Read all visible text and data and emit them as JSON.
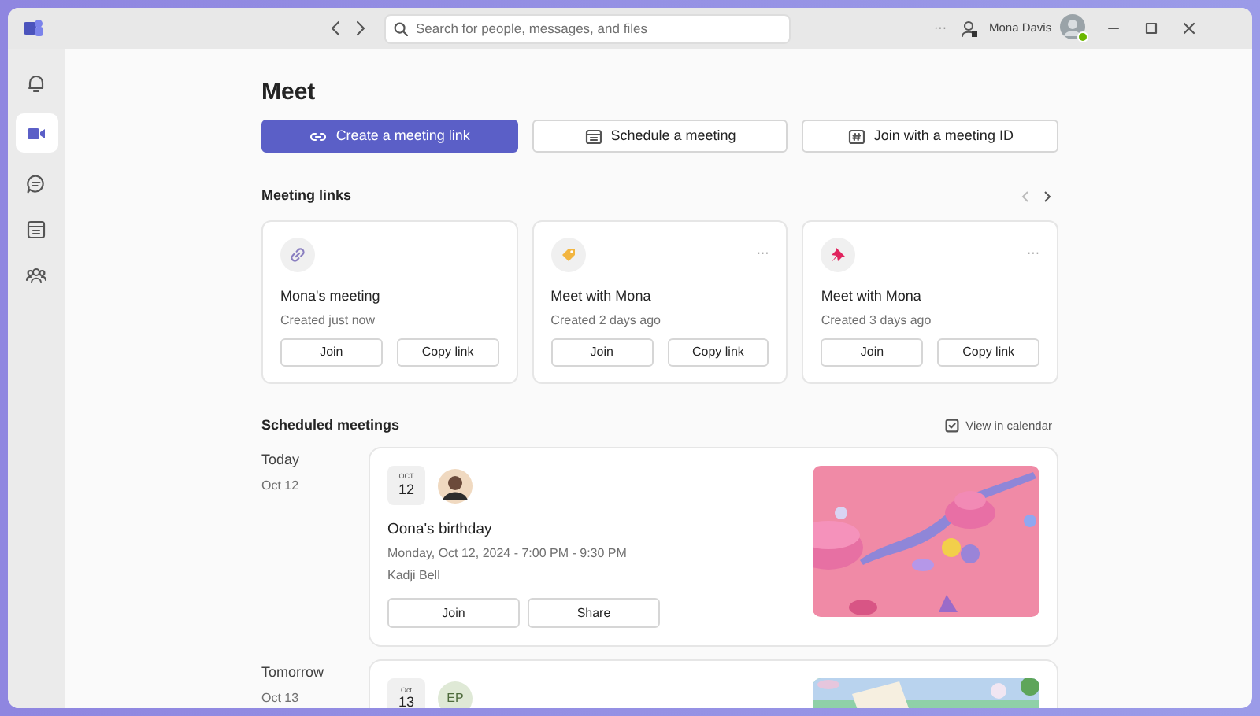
{
  "title_bar": {
    "search": {
      "placeholder": "Search for people, messages, and files"
    },
    "more": "···",
    "user_name": "Mona Davis"
  },
  "rail": [
    {
      "selected": false
    },
    {
      "selected": true
    },
    {
      "selected": false
    },
    {
      "selected": false
    },
    {
      "selected": false
    }
  ],
  "page_title": "Meet",
  "actions": [
    {
      "label": "Create a meeting link",
      "kind": "primary"
    },
    {
      "label": "Schedule a meeting",
      "kind": "secondary"
    },
    {
      "label": "Join with a meeting ID",
      "kind": "secondary"
    }
  ],
  "meeting_links": {
    "title": "Meeting links",
    "cards": [
      {
        "title": "Mona's meeting",
        "subtitle": "Created just now",
        "buttons": [
          "Join",
          "Copy link"
        ]
      },
      {
        "title": "Meet with Mona",
        "subtitle": "Created 2 days ago",
        "more": "···",
        "buttons": [
          "Join",
          "Copy link"
        ]
      },
      {
        "title": "Meet with Mona",
        "subtitle": "Created 3 days ago",
        "more": "···",
        "buttons": [
          "Join",
          "Copy link"
        ]
      }
    ]
  },
  "scheduled": {
    "title": "Scheduled meetings",
    "view_in_calendar": "View in calendar",
    "groups": [
      {
        "day": "Today",
        "date": "Oct 12",
        "meeting": {
          "month": "OCT",
          "day": "12",
          "title": "Oona's birthday",
          "time": "Monday, Oct 12, 2024 - 7:00 PM - 9:30 PM",
          "organizer": "Kadji Bell",
          "buttons": [
            "Join",
            "Share"
          ]
        }
      },
      {
        "day": "Tomorrow",
        "date": "Oct 13",
        "meeting": {
          "month": "Oct",
          "day": "13",
          "avatar": {
            "kind": "initials",
            "initials": "EP"
          }
        }
      }
    ]
  }
}
